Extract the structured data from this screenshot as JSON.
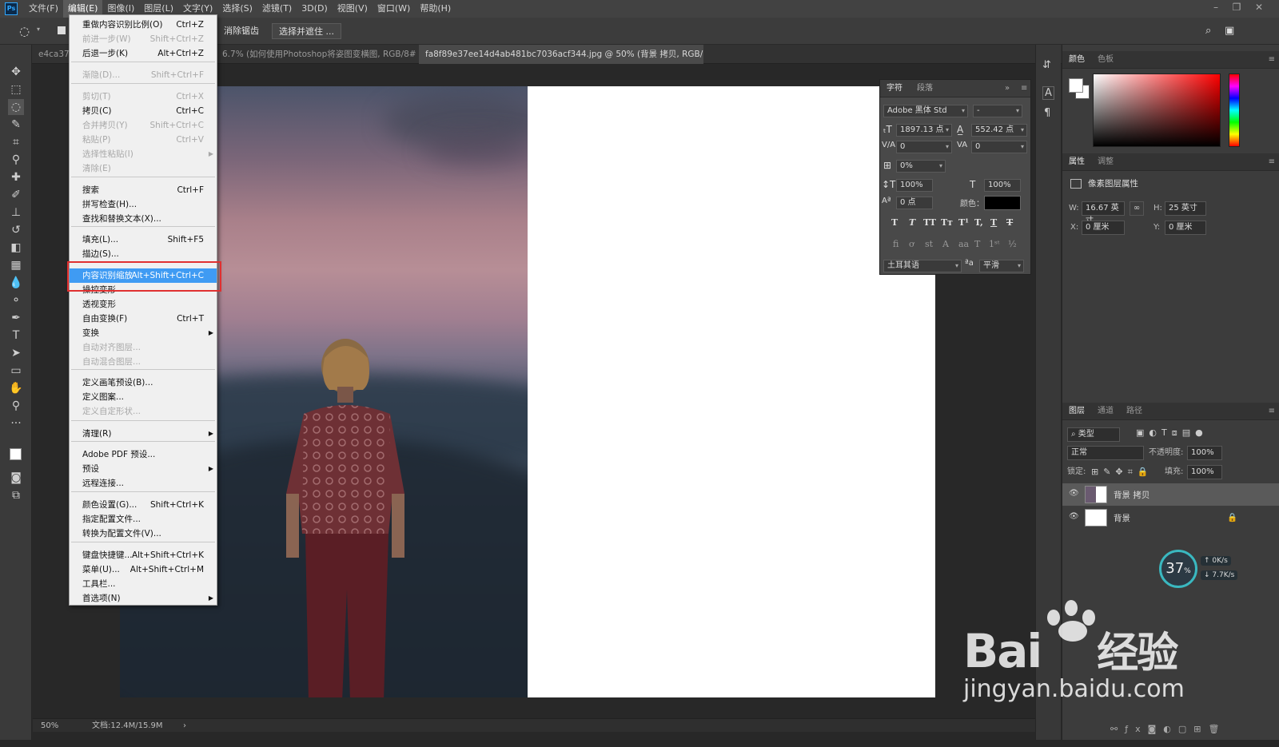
{
  "app": {
    "logo": "Ps"
  },
  "menubar": [
    {
      "label": "文件(F)",
      "active": false
    },
    {
      "label": "编辑(E)",
      "active": true
    },
    {
      "label": "图像(I)",
      "active": false
    },
    {
      "label": "图层(L)",
      "active": false
    },
    {
      "label": "文字(Y)",
      "active": false
    },
    {
      "label": "选择(S)",
      "active": false
    },
    {
      "label": "滤镜(T)",
      "active": false
    },
    {
      "label": "3D(D)",
      "active": false
    },
    {
      "label": "视图(V)",
      "active": false
    },
    {
      "label": "窗口(W)",
      "active": false
    },
    {
      "label": "帮助(H)",
      "active": false
    }
  ],
  "options": {
    "smooth_label": "消除锯齿",
    "select_mask_label": "选择并遮住 ..."
  },
  "tabs": [
    {
      "label": "e4ca37",
      "active": false
    },
    {
      "label": "6.7% (如何使用Photoshop将姿图变横图, RGB/8#) *",
      "active": false,
      "close": "×"
    },
    {
      "label": "fa8f89e37ee14d4ab481bc7036acf344.jpg @ 50% (背景 拷贝, RGB/8#) *",
      "active": true,
      "close": "×"
    }
  ],
  "edit_menu": {
    "items": [
      {
        "label": "重做内容识别比例(O)",
        "shortcut": "Ctrl+Z",
        "disabled": false
      },
      {
        "label": "前进一步(W)",
        "shortcut": "Shift+Ctrl+Z",
        "disabled": true
      },
      {
        "label": "后退一步(K)",
        "shortcut": "Alt+Ctrl+Z",
        "disabled": false
      },
      {
        "label": "渐隐(D)...",
        "shortcut": "Shift+Ctrl+F",
        "disabled": true
      },
      {
        "label": "剪切(T)",
        "shortcut": "Ctrl+X",
        "disabled": true
      },
      {
        "label": "拷贝(C)",
        "shortcut": "Ctrl+C",
        "disabled": false
      },
      {
        "label": "合并拷贝(Y)",
        "shortcut": "Shift+Ctrl+C",
        "disabled": true
      },
      {
        "label": "粘贴(P)",
        "shortcut": "Ctrl+V",
        "disabled": true
      },
      {
        "label": "选择性粘贴(I)",
        "shortcut": "",
        "disabled": true,
        "submenu": true
      },
      {
        "label": "清除(E)",
        "shortcut": "",
        "disabled": true
      },
      {
        "label": "搜索",
        "shortcut": "Ctrl+F",
        "disabled": false
      },
      {
        "label": "拼写检查(H)...",
        "shortcut": "",
        "disabled": false
      },
      {
        "label": "查找和替换文本(X)...",
        "shortcut": "",
        "disabled": false
      },
      {
        "label": "填充(L)...",
        "shortcut": "Shift+F5",
        "disabled": false
      },
      {
        "label": "描边(S)...",
        "shortcut": "",
        "disabled": false
      },
      {
        "label": "内容识别缩放",
        "shortcut": "Alt+Shift+Ctrl+C",
        "disabled": false,
        "highlighted": true
      },
      {
        "label": "操控变形",
        "shortcut": "",
        "disabled": false
      },
      {
        "label": "透视变形",
        "shortcut": "",
        "disabled": false
      },
      {
        "label": "自由变换(F)",
        "shortcut": "Ctrl+T",
        "disabled": false
      },
      {
        "label": "变换",
        "shortcut": "",
        "disabled": false,
        "submenu": true
      },
      {
        "label": "自动对齐图层...",
        "shortcut": "",
        "disabled": true
      },
      {
        "label": "自动混合图层...",
        "shortcut": "",
        "disabled": true
      },
      {
        "label": "定义画笔预设(B)...",
        "shortcut": "",
        "disabled": false
      },
      {
        "label": "定义图案...",
        "shortcut": "",
        "disabled": false
      },
      {
        "label": "定义自定形状...",
        "shortcut": "",
        "disabled": true
      },
      {
        "label": "清理(R)",
        "shortcut": "",
        "disabled": false,
        "submenu": true
      },
      {
        "label": "Adobe PDF 预设...",
        "shortcut": "",
        "disabled": false
      },
      {
        "label": "预设",
        "shortcut": "",
        "disabled": false,
        "submenu": true
      },
      {
        "label": "远程连接...",
        "shortcut": "",
        "disabled": false
      },
      {
        "label": "颜色设置(G)...",
        "shortcut": "Shift+Ctrl+K",
        "disabled": false
      },
      {
        "label": "指定配置文件...",
        "shortcut": "",
        "disabled": false
      },
      {
        "label": "转换为配置文件(V)...",
        "shortcut": "",
        "disabled": false
      },
      {
        "label": "键盘快捷键...",
        "shortcut": "Alt+Shift+Ctrl+K",
        "disabled": false
      },
      {
        "label": "菜单(U)...",
        "shortcut": "Alt+Shift+Ctrl+M",
        "disabled": false
      },
      {
        "label": "工具栏...",
        "shortcut": "",
        "disabled": false
      },
      {
        "label": "首选项(N)",
        "shortcut": "",
        "disabled": false,
        "submenu": true
      }
    ]
  },
  "character_panel": {
    "tabs": [
      "字符",
      "段落"
    ],
    "font_family": "Adobe 黑体 Std",
    "font_style": "-",
    "font_size": "1897.13 点",
    "leading": "552.42 点",
    "kerning": "0",
    "tracking": "0",
    "tsume": "0%",
    "vscale": "100%",
    "hscale": "100%",
    "baseline": "0 点",
    "color_label": "颜色：",
    "language": "土耳其语",
    "antialias": "平滑",
    "aa_icon": "ªa"
  },
  "color_panel": {
    "tabs": [
      "颜色",
      "色板"
    ]
  },
  "properties_panel": {
    "tabs": [
      "属性",
      "调整"
    ],
    "title": "像素图层属性",
    "w_label": "W:",
    "w": "16.67 英寸",
    "h_label": "H:",
    "h": "25 英寸",
    "x_label": "X:",
    "x": "0 厘米",
    "y_label": "Y:",
    "y": "0 厘米"
  },
  "layers_panel": {
    "tabs": [
      "图层",
      "通道",
      "路径"
    ],
    "filter": "类型",
    "blend_mode": "正常",
    "opacity_label": "不透明度:",
    "opacity": "100%",
    "lock_label": "锁定:",
    "fill_label": "填充:",
    "fill": "100%",
    "layers": [
      {
        "name": "背景 拷贝",
        "selected": true
      },
      {
        "name": "背景",
        "selected": false
      }
    ]
  },
  "network_widget": {
    "percent": "37",
    "unit": "%",
    "up": "0K/s",
    "down": "7.7K/s"
  },
  "status": {
    "zoom": "50%",
    "doc": "文档:12.4M/15.9M"
  },
  "watermark": {
    "brand": "Bai",
    "brand_cn": "经验",
    "url": "jingyan.baidu.com"
  }
}
